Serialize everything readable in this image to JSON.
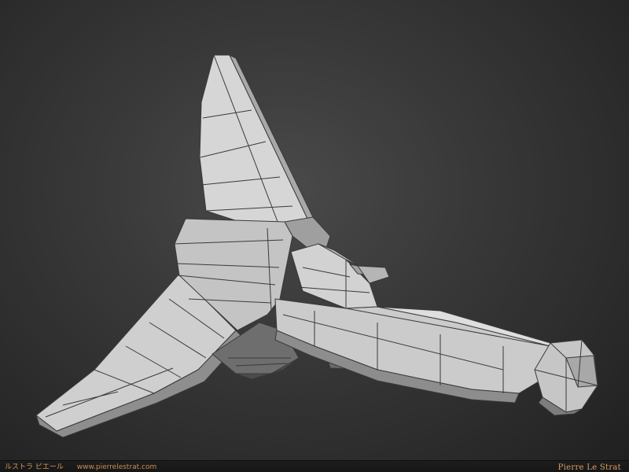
{
  "image": {
    "subject": "",
    "colors": {
      "background_center": "#4a4a4a",
      "background_edge": "#1f1f1f",
      "model_face": "#c8c8c8",
      "model_face_light": "#dcdcdc",
      "model_face_dark": "#8f8f8f",
      "wire": "#3a3a3a",
      "credit_text": "#d39a5a"
    }
  },
  "credits": {
    "japanese_name": "ルストラ ピエール",
    "website": "www.pierrelestrat.com",
    "author": "Pierre Le Strat"
  }
}
